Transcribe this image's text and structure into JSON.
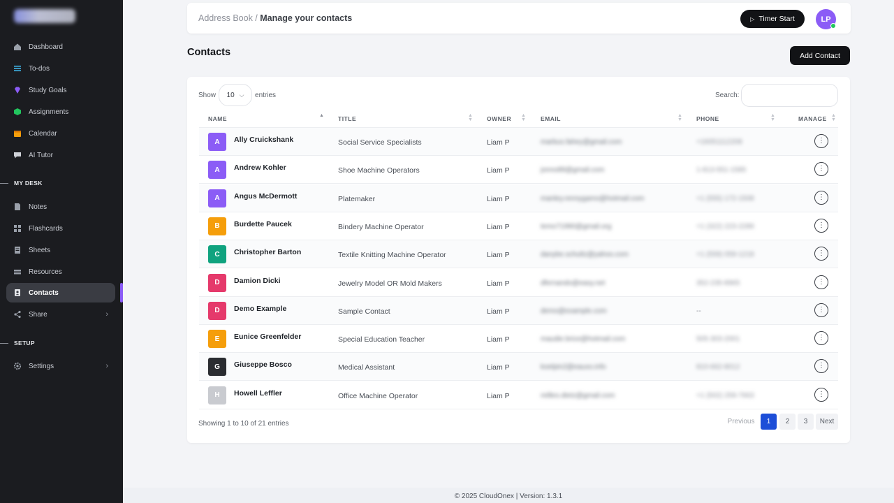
{
  "sidebar": {
    "items": [
      {
        "label": "Dashboard",
        "icon": "dashboard-icon"
      },
      {
        "label": "To-dos",
        "icon": "list-icon"
      },
      {
        "label": "Study Goals",
        "icon": "gem-icon"
      },
      {
        "label": "Assignments",
        "icon": "cube-icon"
      },
      {
        "label": "Calendar",
        "icon": "calendar-icon"
      },
      {
        "label": "AI Tutor",
        "icon": "chat-icon"
      }
    ],
    "my_desk_label": "MY DESK",
    "my_desk_items": [
      {
        "label": "Notes",
        "icon": "note-icon"
      },
      {
        "label": "Flashcards",
        "icon": "grid-icon"
      },
      {
        "label": "Sheets",
        "icon": "sheet-icon"
      },
      {
        "label": "Resources",
        "icon": "stack-icon"
      },
      {
        "label": "Contacts",
        "icon": "contacts-icon",
        "active": true
      },
      {
        "label": "Share",
        "icon": "share-icon"
      }
    ],
    "setup_label": "SETUP",
    "setup_items": [
      {
        "label": "Settings",
        "icon": "gear-icon"
      }
    ]
  },
  "header": {
    "breadcrumb_parent": "Address Book",
    "breadcrumb_sep": " / ",
    "breadcrumb_current": "Manage your contacts",
    "timer_label": "Timer Start",
    "user_initials": "LP"
  },
  "page": {
    "title": "Contacts",
    "add_button": "Add Contact"
  },
  "table": {
    "show_label": "Show",
    "entries_value": "10",
    "entries_label": "entries",
    "search_label": "Search:",
    "columns": [
      "NAME",
      "TITLE",
      "OWNER",
      "EMAIL",
      "PHONE",
      "MANAGE"
    ],
    "rows": [
      {
        "initial": "A",
        "color": "#8b5cf6",
        "name": "Ally Cruickshank",
        "title": "Social Service Specialists",
        "owner": "Liam P",
        "email": "marbus.fahey@gmail.com",
        "phone": "+16051112208"
      },
      {
        "initial": "A",
        "color": "#8b5cf6",
        "name": "Andrew Kohler",
        "title": "Shoe Machine Operators",
        "owner": "Liam P",
        "email": "jonno89@gmail.com",
        "phone": "1-813-551-1585"
      },
      {
        "initial": "A",
        "color": "#8b5cf6",
        "name": "Angus McDermott",
        "title": "Platemaker",
        "owner": "Liam P",
        "email": "manley.rennygamo@hotmail.com",
        "phone": "+1 (555) 172-1508"
      },
      {
        "initial": "B",
        "color": "#f59e0b",
        "name": "Burdette Paucek",
        "title": "Bindery Machine Operator",
        "owner": "Liam P",
        "email": "temo71990@gmail.org",
        "phone": "+1 (322) 223-2289"
      },
      {
        "initial": "C",
        "color": "#10a37f",
        "name": "Christopher Barton",
        "title": "Textile Knitting Machine Operator",
        "owner": "Liam P",
        "email": "danybe.schultz@yahoo.com",
        "phone": "+1 (559) 059-1218"
      },
      {
        "initial": "D",
        "color": "#e5396b",
        "name": "Damion Dicki",
        "title": "Jewelry Model OR Mold Makers",
        "owner": "Liam P",
        "email": "dfernando@easy.net",
        "phone": "352-235-8965"
      },
      {
        "initial": "D",
        "color": "#e5396b",
        "name": "Demo Example",
        "title": "Sample Contact",
        "owner": "Liam P",
        "email": "demo@example.com",
        "phone": "--"
      },
      {
        "initial": "E",
        "color": "#f59e0b",
        "name": "Eunice Greenfelder",
        "title": "Special Education Teacher",
        "owner": "Liam P",
        "email": "maudie.brice@hotmail.com",
        "phone": "505-303-2001"
      },
      {
        "initial": "G",
        "color": "#2b2d31",
        "name": "Giuseppe Bosco",
        "title": "Medical Assistant",
        "owner": "Liam P",
        "email": "koelpin2@eauxo.info",
        "phone": "810-662-8012"
      },
      {
        "initial": "H",
        "color": "#c9cbd0",
        "name": "Howell Leffler",
        "title": "Office Machine Operator",
        "owner": "Liam P",
        "email": "reilleo.dietz@gmail.com",
        "phone": "+1 (502) 259-7663"
      }
    ],
    "manage_glyph": "⋮",
    "info": "Showing 1 to 10 of 21 entries",
    "pagination": {
      "previous": "Previous",
      "pages": [
        "1",
        "2",
        "3"
      ],
      "next": "Next",
      "current": "1"
    }
  },
  "footer": {
    "text": "© 2025 CloudOnex | Version: 1.3.1"
  }
}
